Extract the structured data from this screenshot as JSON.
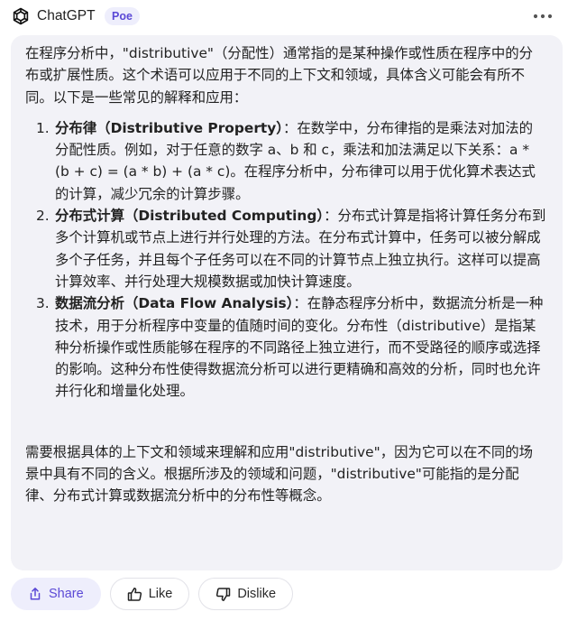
{
  "header": {
    "bot_name": "ChatGPT",
    "badge": "Poe",
    "more_icon": "ellipsis-icon"
  },
  "message": {
    "intro": "在程序分析中，\"distributive\"（分配性）通常指的是某种操作或性质在程序中的分布或扩展性质。这个术语可以应用于不同的上下文和领域，具体含义可能会有所不同。以下是一些常见的解释和应用：",
    "items": [
      {
        "number": "1.",
        "title": "分布律（Distributive Property）",
        "body": "：在数学中，分布律指的是乘法对加法的分配性质。例如，对于任意的数字 a、b 和 c，乘法和加法满足以下关系：a * (b + c) = (a * b) + (a * c)。在程序分析中，分布律可以用于优化算术表达式的计算，减少冗余的计算步骤。"
      },
      {
        "number": "2.",
        "title": "分布式计算（Distributed Computing）",
        "body": "：分布式计算是指将计算任务分布到多个计算机或节点上进行并行处理的方法。在分布式计算中，任务可以被分解成多个子任务，并且每个子任务可以在不同的计算节点上独立执行。这样可以提高计算效率、并行处理大规模数据或加快计算速度。"
      },
      {
        "number": "3.",
        "title": "数据流分析（Data Flow Analysis）",
        "body": "：在静态程序分析中，数据流分析是一种技术，用于分析程序中变量的值随时间的变化。分布性（distributive）是指某种分析操作或性质能够在程序的不同路径上独立进行，而不受路径的顺序或选择的影响。这种分布性使得数据流分析可以进行更精确和高效的分析，同时也允许并行化和增量化处理。"
      }
    ],
    "closing": "需要根据具体的上下文和领域来理解和应用\"distributive\"，因为它可以在不同的场景中具有不同的含义。根据所涉及的领域和问题，\"distributive\"可能指的是分配律、分布式计算或数据流分析中的分布性等概念。"
  },
  "actions": {
    "share_label": "Share",
    "like_label": "Like",
    "dislike_label": "Dislike"
  },
  "colors": {
    "accent": "#5b49d6",
    "bubble_bg": "#f2f2f7",
    "badge_bg": "#eeeefc"
  }
}
